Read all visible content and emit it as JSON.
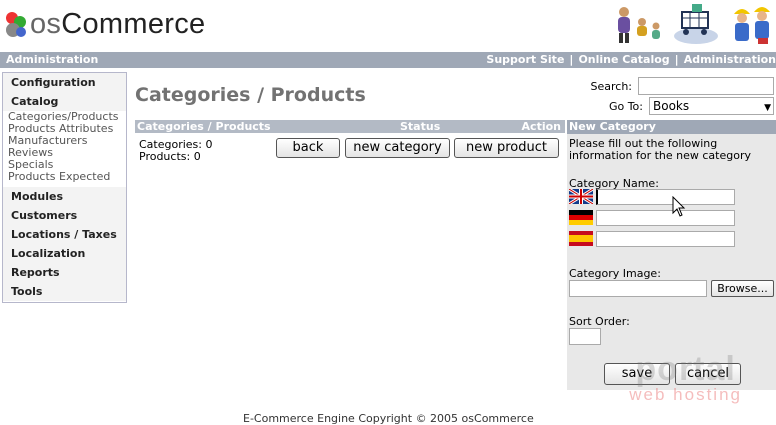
{
  "logo": {
    "prefix": "os",
    "suffix": "Commerce"
  },
  "topbar": {
    "left": "Administration",
    "links": [
      "Support Site",
      "Online Catalog",
      "Administration"
    ]
  },
  "sidebar": {
    "configuration": "Configuration",
    "catalog": "Catalog",
    "catalog_items": [
      "Categories/Products",
      "Products Attributes",
      "Manufacturers",
      "Reviews",
      "Specials",
      "Products Expected"
    ],
    "modules": "Modules",
    "customers": "Customers",
    "locations": "Locations / Taxes",
    "localization": "Localization",
    "reports": "Reports",
    "tools": "Tools"
  },
  "page_title": "Categories / Products",
  "search": {
    "label": "Search:",
    "value": ""
  },
  "goto": {
    "label": "Go To:",
    "selected": "Books"
  },
  "table": {
    "col_categories": "Categories / Products",
    "col_status": "Status",
    "col_action": "Action",
    "categories_count": "Categories: 0",
    "products_count": "Products: 0"
  },
  "buttons": {
    "back": "back",
    "new_category": "new category",
    "new_product": "new product"
  },
  "new_category": {
    "heading": "New Category",
    "intro_line1": "Please fill out the following",
    "intro_line2": "information for the new category",
    "name_label": "Category Name:",
    "image_label": "Category Image:",
    "browse": "Browse...",
    "sort_label": "Sort Order:",
    "save": "save",
    "cancel": "cancel"
  },
  "footer": "E-Commerce Engine Copyright © 2005 osCommerce",
  "watermark": {
    "brand": "portal",
    "sub": "web hosting"
  },
  "colors": {
    "bar": "#9fa8b6",
    "title": "#727272",
    "panel": "#e8e8e8"
  }
}
